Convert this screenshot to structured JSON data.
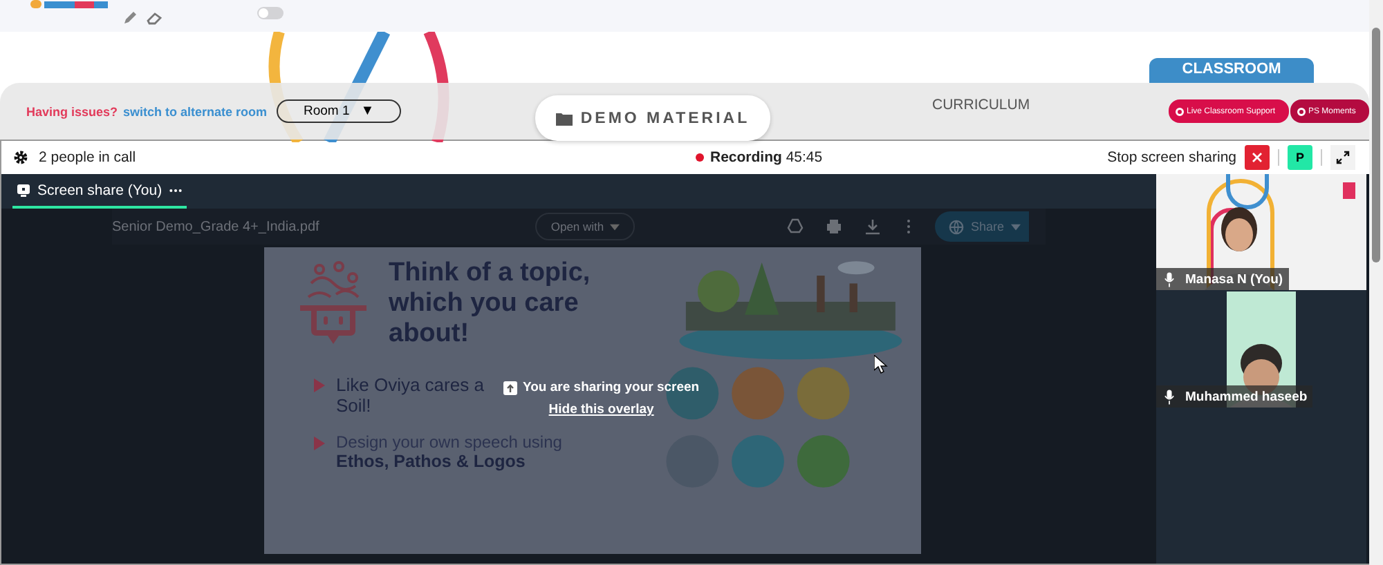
{
  "top_bar": {
    "toggle": {
      "on": false
    }
  },
  "notice": {
    "issue": "Having issues?",
    "link": "switch to alternate room"
  },
  "room_select": {
    "value": "Room 1",
    "caret": "▼"
  },
  "demo_button": "DEMO MATERIAL",
  "curriculum_tab": "CURRICULUM",
  "classroom_tab": "CLASSROOM",
  "support_buttons": [
    "Live Classroom Support",
    "PS Moments"
  ],
  "call_header": {
    "people": "2 people in call",
    "recording": {
      "label": "Recording",
      "time": "45:45"
    },
    "stop_label": "Stop screen sharing",
    "avatar": "P"
  },
  "stage_tab": {
    "label": "Screen share (You)",
    "selected": true
  },
  "pdf_bar": {
    "filename": "Senior Demo_Grade 4+_India.pdf",
    "open_with": "Open with",
    "share": "Share"
  },
  "slide": {
    "title": "Think of a topic, which you care about!",
    "bullets": [
      {
        "lines": [
          {
            "text": "Like Oviya cares a",
            "kind": "plain"
          },
          {
            "text": "Soil!",
            "kind": "plain"
          }
        ]
      },
      {
        "lines": [
          {
            "text": "Design your own speech using",
            "kind": "light"
          },
          {
            "text": "Ethos, Pathos & Logos",
            "kind": "bold"
          }
        ]
      }
    ]
  },
  "overlay": {
    "message": "You are sharing your screen",
    "link": "Hide this overlay"
  },
  "participants": [
    {
      "name": "Manasa N (You)",
      "kind": "light"
    },
    {
      "name": "Muhammed haseeb",
      "kind": "dark"
    }
  ]
}
